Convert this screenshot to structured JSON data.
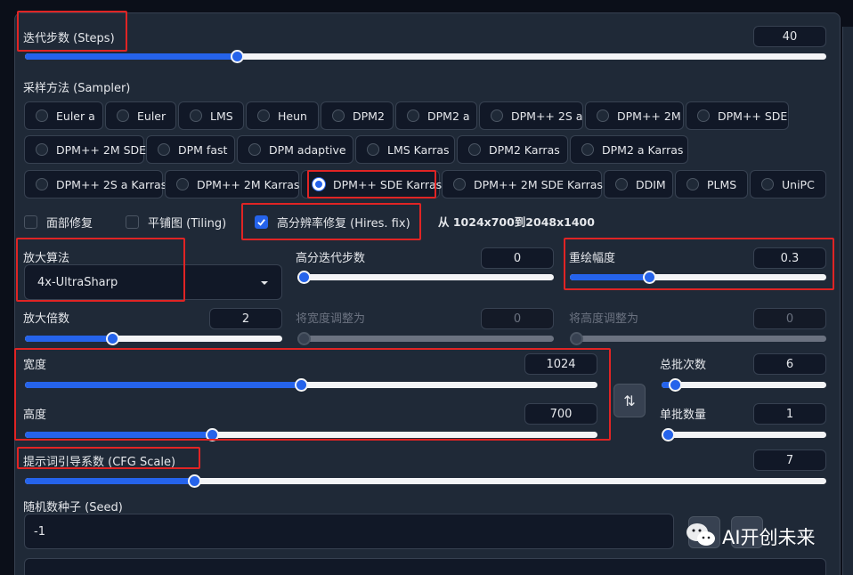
{
  "steps": {
    "label": "迭代步数 (Steps)",
    "value": "40",
    "fraction": 0.16
  },
  "sampler": {
    "label": "采样方法 (Sampler)",
    "options": [
      "Euler a",
      "Euler",
      "LMS",
      "Heun",
      "DPM2",
      "DPM2 a",
      "DPM++ 2S a",
      "DPM++ 2M",
      "DPM++ SDE",
      "DPM++ 2M SDE",
      "DPM fast",
      "DPM adaptive",
      "LMS Karras",
      "DPM2 Karras",
      "DPM2 a Karras",
      "DPM++ 2S a Karras",
      "DPM++ 2M Karras",
      "DPM++ SDE Karras",
      "DPM++ 2M SDE Karras",
      "DDIM",
      "PLMS",
      "UniPC"
    ],
    "selected": "DPM++ SDE Karras"
  },
  "options": {
    "face_restore": "面部修复",
    "tiling": "平铺图 (Tiling)",
    "hires_fix": "高分辨率修复 (Hires. fix)",
    "hires_info": "从 1024x700到2048x1400"
  },
  "upscaler": {
    "label": "放大算法",
    "value": "4x-UltraSharp"
  },
  "hires_steps": {
    "label": "高分迭代步数",
    "value": "0",
    "fraction": 0.0
  },
  "denoise": {
    "label": "重绘幅度",
    "value": "0.3",
    "fraction": 0.3
  },
  "upscale_by": {
    "label": "放大倍数",
    "value": "2",
    "fraction": 0.33
  },
  "resize_w": {
    "label": "将宽度调整为",
    "value": "0",
    "fraction": 0.0
  },
  "resize_h": {
    "label": "将高度调整为",
    "value": "0",
    "fraction": 0.0
  },
  "width": {
    "label": "宽度",
    "value": "1024",
    "fraction": 0.48
  },
  "height": {
    "label": "高度",
    "value": "700",
    "fraction": 0.33
  },
  "swap_icon": "⇅",
  "batch_count": {
    "label": "总批次数",
    "value": "6",
    "fraction": 0.06
  },
  "batch_size": {
    "label": "单批数量",
    "value": "1",
    "fraction": 0.0
  },
  "cfg": {
    "label": "提示词引导系数 (CFG Scale)",
    "value": "7",
    "fraction": 0.21
  },
  "seed": {
    "label": "随机数种子 (Seed)",
    "value": "-1"
  },
  "watermark": "AI开创未来",
  "accent": "#2563eb",
  "highlight": "#e02424"
}
